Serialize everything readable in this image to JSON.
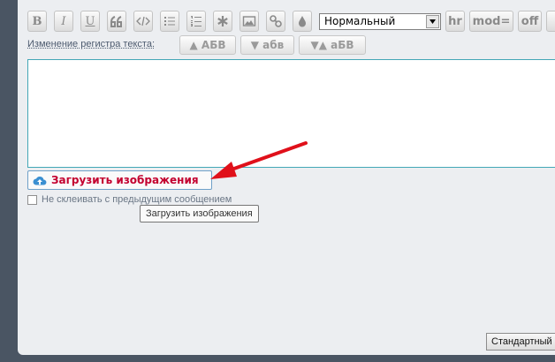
{
  "toolbar": {
    "bold_label": "B",
    "italic_label": "I",
    "underline_label": "U",
    "format_select": {
      "value": "Нормальный"
    },
    "hr_label": "hr",
    "mod_label": "mod=",
    "off_label": "off"
  },
  "case_change": {
    "label": "Изменение регистра текста:",
    "upper": "▲ АБВ",
    "lower": "▼ абв",
    "toggle": "▼▲ аБВ"
  },
  "editor": {
    "value": ""
  },
  "upload": {
    "button_label": "Загрузить изображения",
    "tooltip": "Загрузить изображения"
  },
  "merge_option": {
    "label": "Не склеивать с предыдущим сообщением",
    "checked": false
  },
  "bottom": {
    "button_label": "Стандартный"
  },
  "colors": {
    "upload_text": "#c3002f",
    "annotation_arrow": "#e0101a",
    "editor_border": "#43a7b6"
  }
}
